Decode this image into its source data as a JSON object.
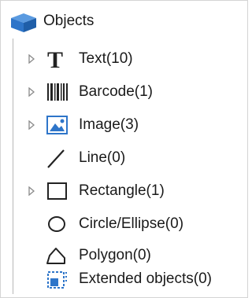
{
  "panel": {
    "title": "Objects",
    "root_icon": "cube-icon"
  },
  "items": [
    {
      "label": "Text(10)",
      "icon": "text-T-icon",
      "expandable": true
    },
    {
      "label": "Barcode(1)",
      "icon": "barcode-icon",
      "expandable": true
    },
    {
      "label": "Image(3)",
      "icon": "image-icon",
      "expandable": true
    },
    {
      "label": "Line(0)",
      "icon": "line-icon",
      "expandable": false
    },
    {
      "label": "Rectangle(1)",
      "icon": "rectangle-icon",
      "expandable": true
    },
    {
      "label": "Circle/Ellipse(0)",
      "icon": "ellipse-icon",
      "expandable": false
    },
    {
      "label": "Polygon(0)",
      "icon": "polygon-icon",
      "expandable": false
    },
    {
      "label": "Extended objects(0)",
      "icon": "extended-objects-icon",
      "expandable": false
    }
  ],
  "colors": {
    "accent_blue": "#2e75c9",
    "icon_dark": "#222222",
    "chevron": "#8a8a8a",
    "tree_line": "#b7b7b7"
  }
}
